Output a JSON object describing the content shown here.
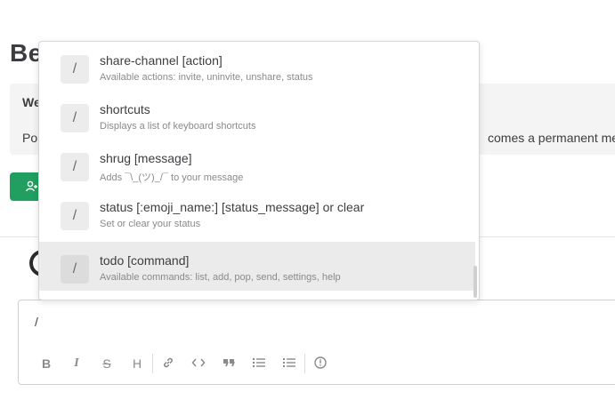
{
  "page": {
    "title_partial": "Be",
    "welcome_heading_partial": "We",
    "welcome_text_left_partial": "Po",
    "welcome_text_right_partial": "comes a permanent me"
  },
  "editor": {
    "value": "/",
    "toolbar_labels": {
      "bold": "B",
      "italic": "I",
      "strike": "S",
      "heading": "H"
    }
  },
  "autocomplete": {
    "items": [
      {
        "icon": "/",
        "name": "share-channel [action]",
        "description": "Available actions: invite, uninvite, unshare, status"
      },
      {
        "icon": "/",
        "name": "shortcuts",
        "description": "Displays a list of keyboard shortcuts"
      },
      {
        "icon": "/",
        "name": "shrug [message]",
        "description": "Adds ¯\\_(ツ)_/¯ to your message"
      },
      {
        "icon": "/",
        "name": "status [:emoji_name:] [status_message] or clear",
        "description": "Set or clear your status"
      },
      {
        "icon": "/",
        "name": "todo [command]",
        "description": "Available commands: list, add, pop, send, settings, help"
      }
    ],
    "selected_index": 4
  },
  "colors": {
    "accent_green": "#219f60",
    "selected_row": "#ebebeb"
  }
}
